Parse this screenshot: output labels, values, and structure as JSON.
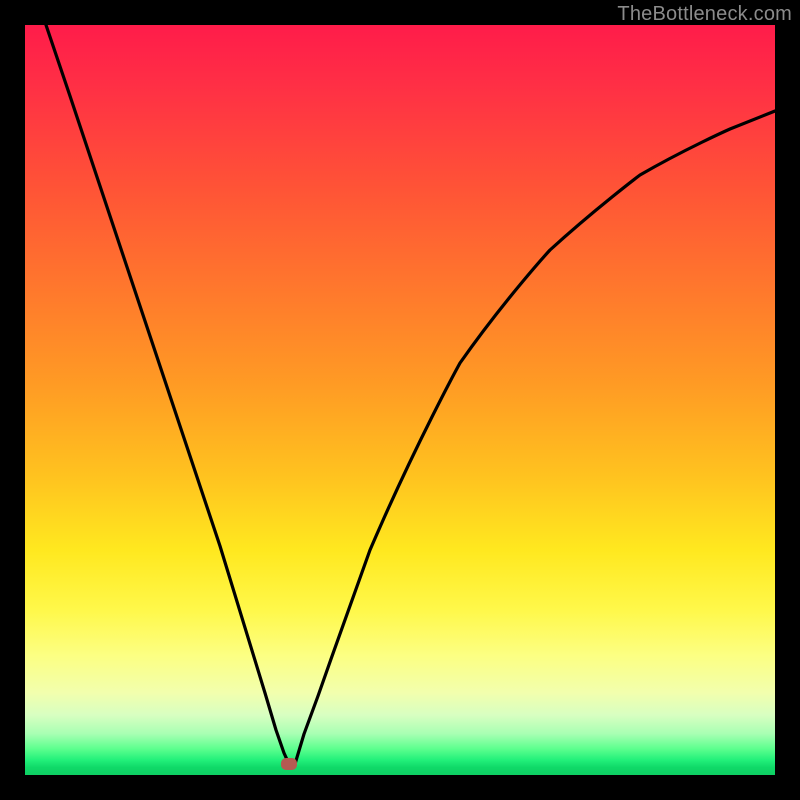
{
  "watermark": "TheBottleneck.com",
  "marker": {
    "x_frac": 0.352,
    "y_frac": 0.985
  },
  "chart_data": {
    "type": "line",
    "title": "",
    "xlabel": "",
    "ylabel": "",
    "xlim": [
      0,
      1
    ],
    "ylim": [
      0,
      1
    ],
    "series": [
      {
        "name": "bottleneck-curve",
        "x": [
          0.028,
          0.06,
          0.1,
          0.14,
          0.18,
          0.22,
          0.26,
          0.3,
          0.32,
          0.335,
          0.345,
          0.352,
          0.36,
          0.372,
          0.39,
          0.42,
          0.46,
          0.52,
          0.58,
          0.64,
          0.7,
          0.76,
          0.82,
          0.88,
          0.94,
          1.0
        ],
        "y": [
          1.0,
          0.905,
          0.785,
          0.665,
          0.545,
          0.425,
          0.305,
          0.175,
          0.11,
          0.06,
          0.03,
          0.015,
          0.028,
          0.055,
          0.105,
          0.19,
          0.3,
          0.44,
          0.55,
          0.635,
          0.7,
          0.755,
          0.8,
          0.835,
          0.862,
          0.885
        ]
      }
    ],
    "annotations": [
      {
        "name": "marker",
        "x": 0.352,
        "y": 0.015,
        "color": "#b55a52"
      }
    ],
    "background_gradient": {
      "top": "#ff1c4a",
      "mid": "#ffe81f",
      "bottom": "#0ecf63"
    }
  }
}
